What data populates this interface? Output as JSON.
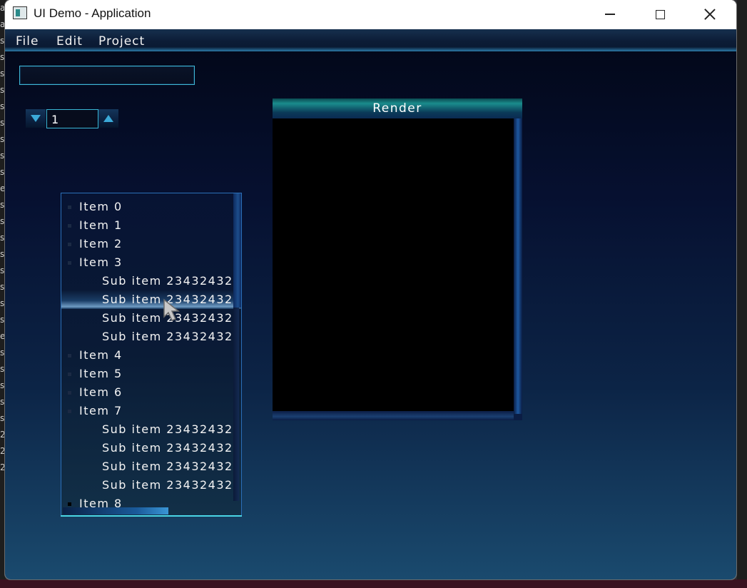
{
  "window": {
    "title": "UI Demo - Application",
    "controls": [
      "minimize-icon",
      "maximize-icon",
      "close-icon"
    ]
  },
  "menu": {
    "items": [
      {
        "label": "File"
      },
      {
        "label": "Edit"
      },
      {
        "label": "Project"
      }
    ]
  },
  "textfield": {
    "value": ""
  },
  "spinner": {
    "value": "1"
  },
  "render": {
    "title": "Render"
  },
  "tree": {
    "items": [
      {
        "label": "Item 0"
      },
      {
        "label": "Item 1"
      },
      {
        "label": "Item 2"
      },
      {
        "label": "Item 3"
      },
      {
        "label": "Sub item 23432432"
      },
      {
        "label": "Sub item 23432432"
      },
      {
        "label": "Sub item 23432432"
      },
      {
        "label": "Sub item 23432432"
      },
      {
        "label": "Item 4"
      },
      {
        "label": "Item 5"
      },
      {
        "label": "Item 6"
      },
      {
        "label": "Item 7"
      },
      {
        "label": "Sub item 23432432"
      },
      {
        "label": "Sub item 23432432"
      },
      {
        "label": "Sub item 23432432"
      },
      {
        "label": "Sub item 23432432"
      },
      {
        "label": "Item 8"
      }
    ]
  },
  "colors": {
    "accent_border": "#3fb6d4",
    "menubar": "#0c1c36",
    "render_header": "#1a8c8c",
    "background_bottom": "#1a4a6e"
  }
}
